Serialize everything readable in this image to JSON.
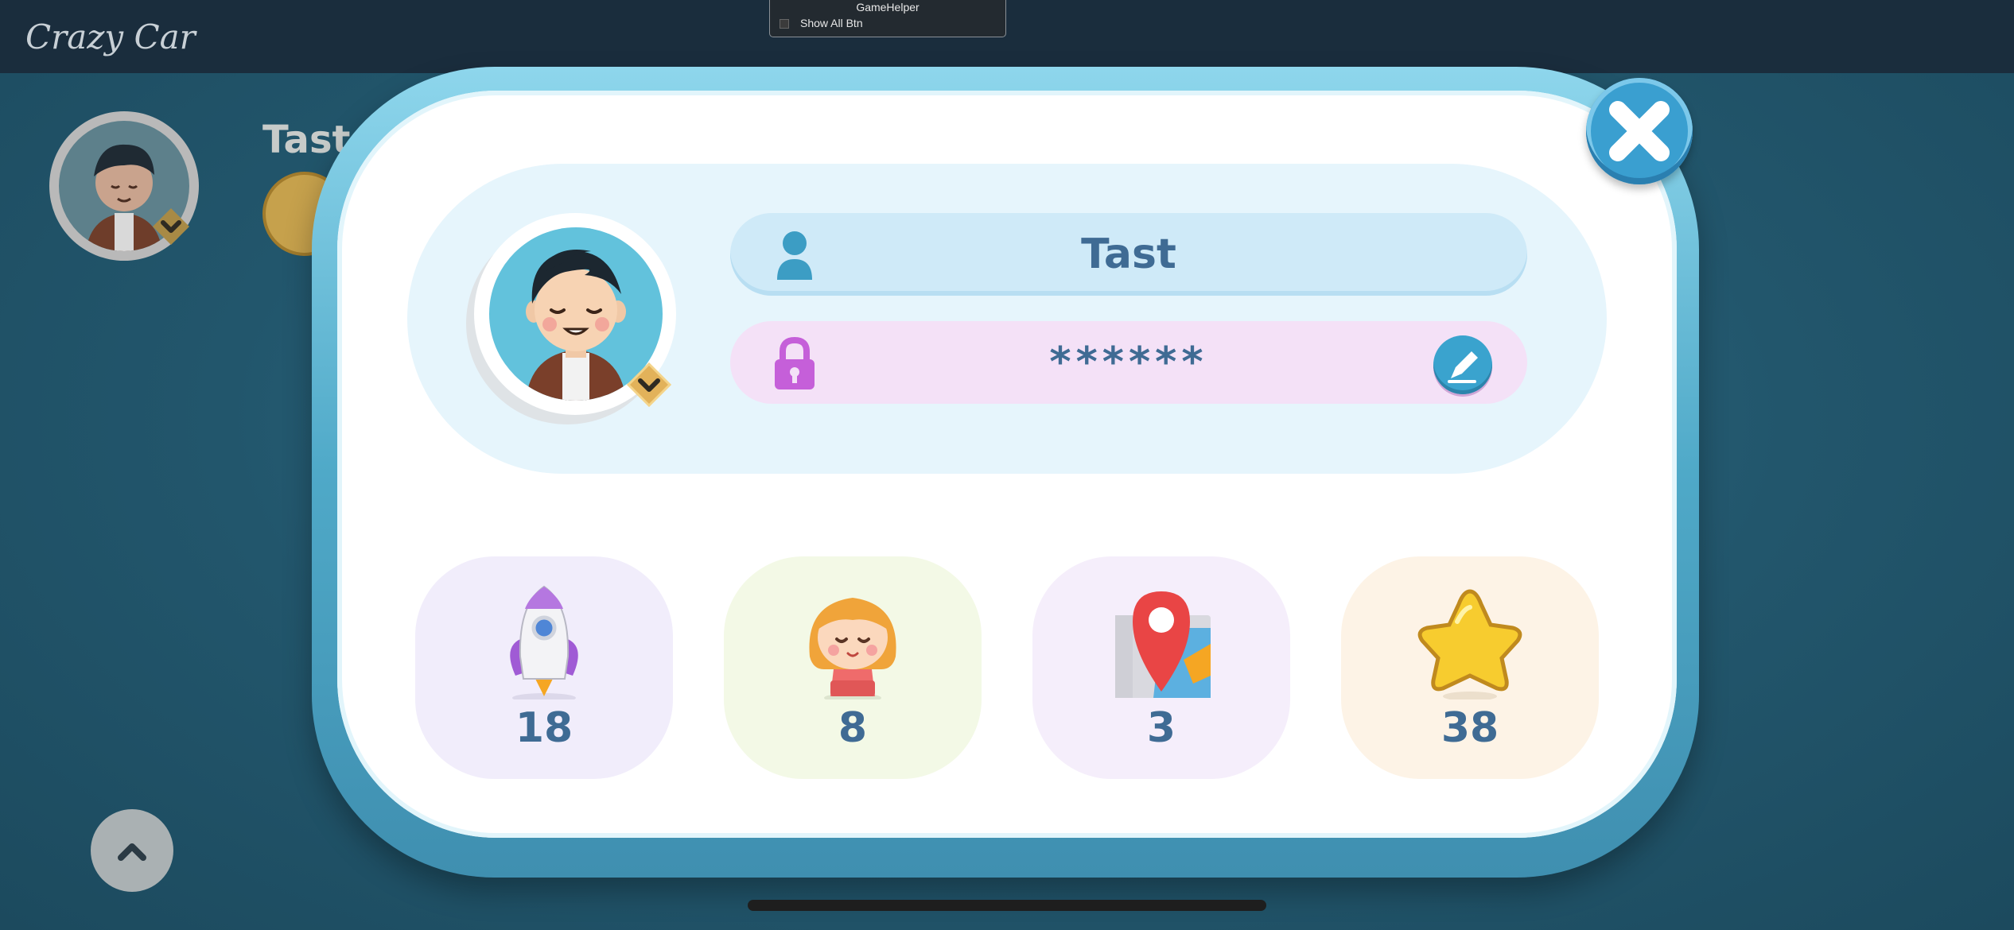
{
  "app": {
    "title": "Crazy Car"
  },
  "game_helper": {
    "title": "GameHelper",
    "option_label": "Show All Btn",
    "option_checked": false
  },
  "background": {
    "player_name": "Tast"
  },
  "profile": {
    "name": "Tast",
    "password_mask": "******",
    "avatar_icon": "boy-avatar",
    "badge_icon": "chevron-down-badge-icon",
    "user_icon": "user-icon",
    "lock_icon": "lock-icon",
    "edit_icon": "pencil-icon"
  },
  "stats": [
    {
      "icon": "rocket-icon",
      "value": "18",
      "color": "#f1edfb"
    },
    {
      "icon": "girl-character-icon",
      "value": "8",
      "color": "#f3f9e6"
    },
    {
      "icon": "map-pin-icon",
      "value": "3",
      "color": "#f5eefb"
    },
    {
      "icon": "star-icon",
      "value": "38",
      "color": "#fdf3e6"
    }
  ],
  "close_icon": "close-x-icon",
  "up_icon": "chevron-up-icon",
  "colors": {
    "accent_blue": "#3a9fd0",
    "text_blue": "#3f6b94",
    "frame_blue": "#4fa9c8"
  }
}
